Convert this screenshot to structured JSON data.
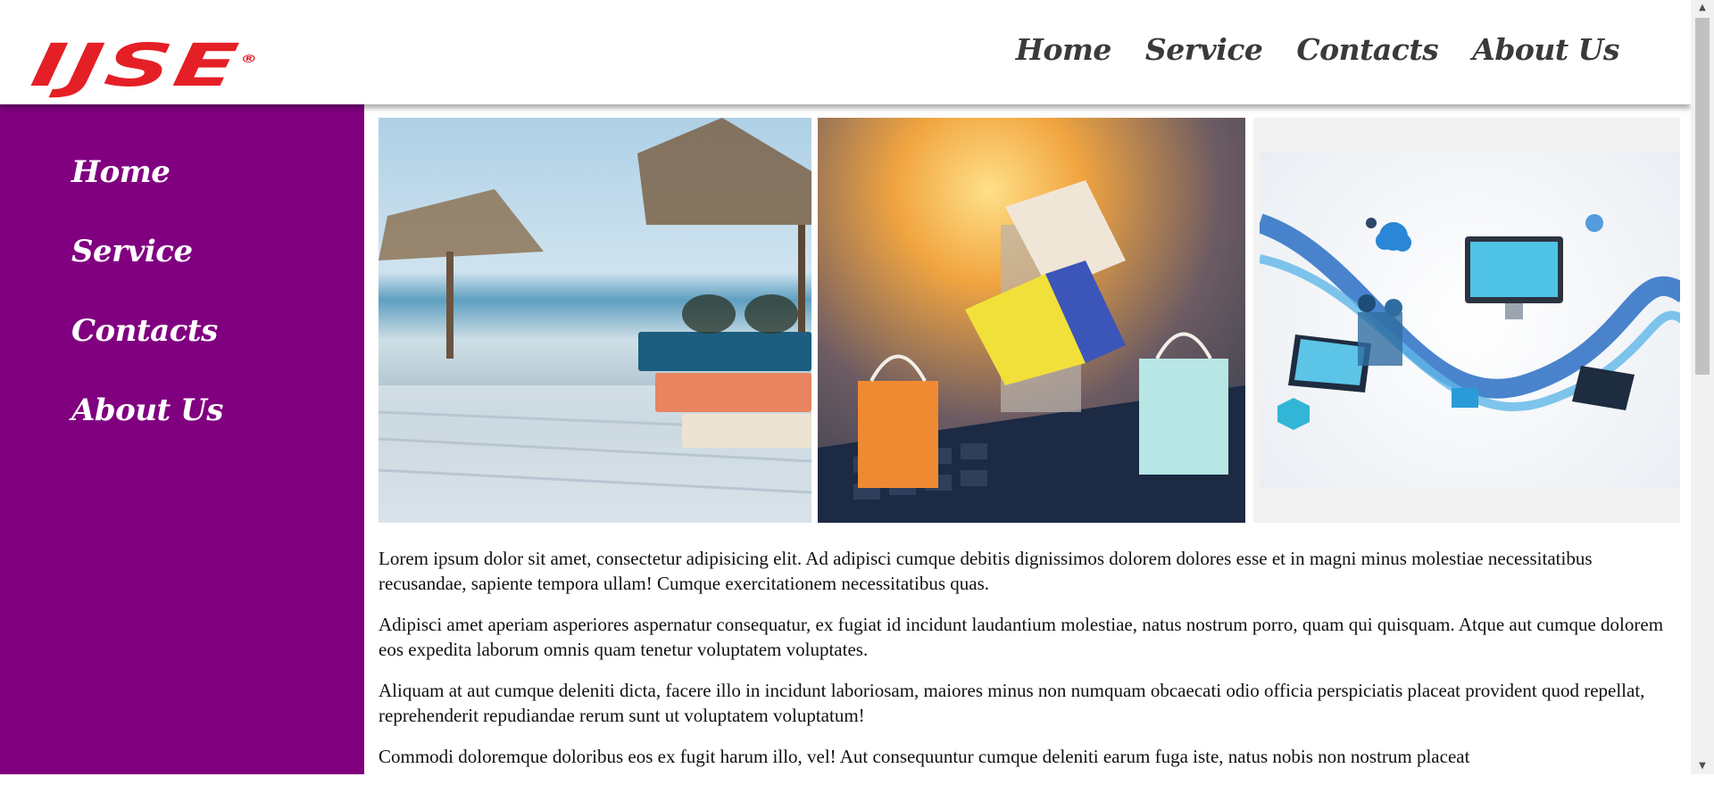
{
  "brand": {
    "logo_text": "IJSE",
    "registered": "®",
    "logo_color": "#e51f26"
  },
  "colors": {
    "sidebar_bg": "#800080",
    "nav_text": "#3a3a3a",
    "sidebar_text": "#ffffff"
  },
  "top_nav": [
    "Home",
    "Service",
    "Contacts",
    "About Us"
  ],
  "side_nav": [
    "Home",
    "Service",
    "Contacts",
    "About Us"
  ],
  "main": {
    "images": [
      {
        "name": "beach-books-sunglasses-image"
      },
      {
        "name": "shopping-bags-cart-laptop-image"
      },
      {
        "name": "digital-technology-network-image"
      }
    ],
    "paragraphs": [
      "Lorem ipsum dolor sit amet, consectetur adipisicing elit. Ad adipisci cumque debitis dignissimos dolorem dolores esse et in magni minus molestiae necessitatibus recusandae, sapiente tempora ullam! Cumque exercitationem necessitatibus quas.",
      "Adipisci amet aperiam asperiores aspernatur consequatur, ex fugiat id incidunt laudantium molestiae, natus nostrum porro, quam qui quisquam. Atque aut cumque dolorem eos expedita laborum omnis quam tenetur voluptatem voluptates.",
      "Aliquam at aut cumque deleniti dicta, facere illo in incidunt laboriosam, maiores minus non numquam obcaecati odio officia perspiciatis placeat provident quod repellat, reprehenderit repudiandae rerum sunt ut voluptatem voluptatum!",
      "Commodi doloremque doloribus eos ex fugit harum illo, vel! Aut consequuntur cumque deleniti earum fuga iste, natus nobis non nostrum placeat"
    ]
  },
  "scrollbar": {
    "up_icon": "scroll-up-icon",
    "down_icon": "scroll-down-icon"
  }
}
